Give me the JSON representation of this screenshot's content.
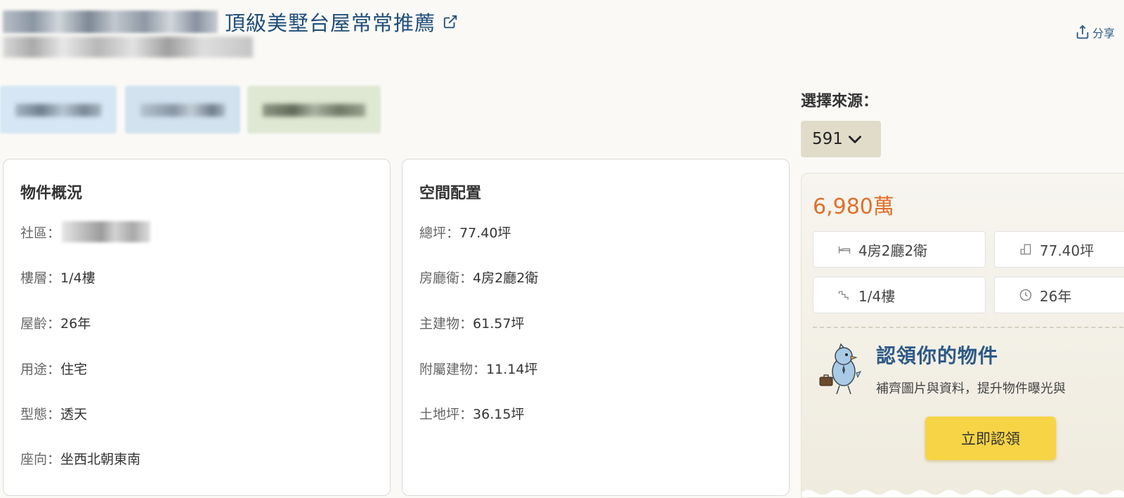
{
  "header": {
    "title": "頂級美墅台屋常常推薦",
    "share_label": "分享"
  },
  "source": {
    "label": "選擇來源：",
    "selected": "591"
  },
  "overview": {
    "title": "物件概況",
    "rows": [
      {
        "key": "社區：",
        "value": ""
      },
      {
        "key": "樓層：",
        "value": "1/4樓"
      },
      {
        "key": "屋齡：",
        "value": "26年"
      },
      {
        "key": "用途：",
        "value": "住宅"
      },
      {
        "key": "型態：",
        "value": "透天"
      },
      {
        "key": "座向：",
        "value": "坐西北朝東南"
      }
    ]
  },
  "space": {
    "title": "空間配置",
    "rows": [
      {
        "key": "總坪：",
        "value": "77.40坪"
      },
      {
        "key": "房廳衛：",
        "value": "4房2廳2衛"
      },
      {
        "key": "主建物：",
        "value": "61.57坪"
      },
      {
        "key": "附屬建物：",
        "value": "11.14坪"
      },
      {
        "key": "土地坪：",
        "value": "36.15坪"
      }
    ]
  },
  "listing": {
    "price": "6,980萬",
    "specs": [
      {
        "icon": "bed-icon",
        "text": "4房2廳2衛"
      },
      {
        "icon": "floor-plan-icon",
        "text": "77.40坪"
      },
      {
        "icon": "stairs-icon",
        "text": "1/4樓"
      },
      {
        "icon": "clock-icon",
        "text": "26年"
      }
    ],
    "claim_title": "認領你的物件",
    "claim_subtitle": "補齊圖片與資料，提升物件曝光與",
    "claim_button": "立即認領"
  },
  "colors": {
    "title": "#1f4e79",
    "price": "#e0702a",
    "claim_button": "#f6d445",
    "select_bg": "#e0dcc9"
  }
}
